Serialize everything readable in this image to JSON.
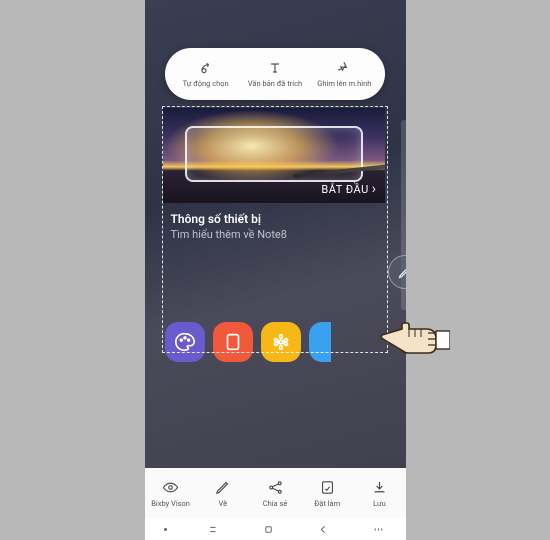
{
  "pill": {
    "auto_select": "Tự động chọn",
    "extract_text": "Văn bản đã trích",
    "pin_screen": "Ghim lên m.hình"
  },
  "banner": {
    "cta": "BẮT ĐẦU",
    "chevron": "›"
  },
  "card": {
    "title": "Thông số thiết bị",
    "subtitle": "Tìm hiểu thêm về Note8"
  },
  "apps": {
    "colors": {
      "palette": "#6a5acd",
      "notes": "#f05a3a",
      "star": "#f7b817",
      "music": "#3aa0f0"
    }
  },
  "toolbar": {
    "bixby": "Bixby Vison",
    "draw": "Vẽ",
    "share": "Chia sẻ",
    "setas": "Đặt làm",
    "save": "Lưu"
  }
}
